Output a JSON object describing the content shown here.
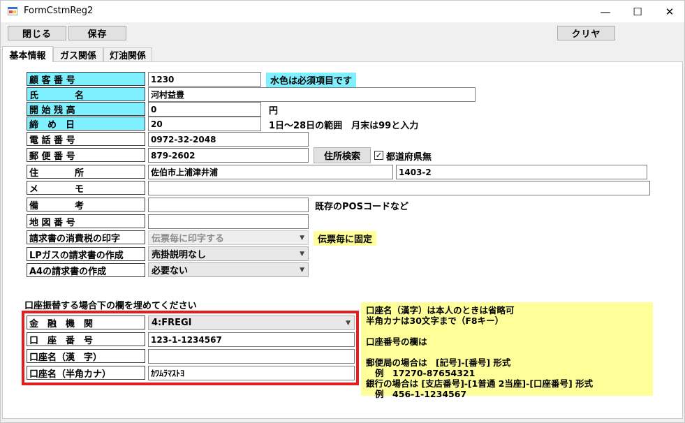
{
  "window": {
    "title": "FormCstmReg2",
    "min_glyph": "—",
    "max_glyph": "☐",
    "close_glyph": "✕"
  },
  "toolbar": {
    "close_label": "閉じる",
    "save_label": "保存",
    "clear_label": "クリヤ"
  },
  "tabs": [
    {
      "label": "基本情報"
    },
    {
      "label": "ガス関係"
    },
    {
      "label": "灯油関係"
    }
  ],
  "form": {
    "customer_no": {
      "label": "顧 客 番 号",
      "value": "1230"
    },
    "required_note": "水色は必須項目です",
    "name": {
      "label": "氏　　　　名",
      "value": "河村益豊"
    },
    "opening_balance": {
      "label": "開 始 残 高",
      "value": "0",
      "unit": "円"
    },
    "closing_day": {
      "label": "締　め　日",
      "value": "20",
      "hint": "1日～28日の範囲　月末は99と入力"
    },
    "phone": {
      "label": "電 話 番 号",
      "value": "0972-32-2048"
    },
    "postal": {
      "label": "郵 便 番 号",
      "value": "879-2602",
      "search_label": "住所検索",
      "check_label": "都道府県無",
      "checked": true
    },
    "address": {
      "label": "住　　　　所",
      "value1": "佐伯市上浦津井浦",
      "value2": "1403-2"
    },
    "memo": {
      "label": "メ　　　　モ",
      "value": ""
    },
    "remarks": {
      "label": "備　　　　考",
      "value": "",
      "hint": "既存のPOSコードなど"
    },
    "map_no": {
      "label": "地 図 番 号",
      "value": ""
    },
    "tax_print": {
      "label": "請求書の消費税の印字",
      "value": "伝票毎に印字する",
      "note": "伝票毎に固定"
    },
    "lpgas_invoice": {
      "label": "LPガスの請求書の作成",
      "value": "売掛説明なし"
    },
    "a4_invoice": {
      "label": "A4の請求書の作成",
      "value": "必要ない"
    }
  },
  "bank": {
    "heading": "口座振替する場合下の欄を埋めてください",
    "institution": {
      "label": "金　融　機　関",
      "value": "4:FREGI"
    },
    "account_no": {
      "label": "口　座　番　号",
      "value": "123-1-1234567"
    },
    "name_kanji": {
      "label": "口座名（漢　字）",
      "value": ""
    },
    "name_kana": {
      "label": "口座名（半角カナ）",
      "value": "ｶﾜﾑﾗﾏｽﾄﾖ"
    },
    "notes": [
      "口座名（漢字）は本人のときは省略可",
      "半角カナは30文字まで（F8キー）",
      "",
      "口座番号の欄は",
      "",
      "郵便局の場合は　[記号]-[番号] 形式",
      "   例　17270-87654321",
      "銀行の場合は [支店番号]-[1普通 2当座]-[口座番号] 形式",
      "   例　456-1-1234567"
    ]
  }
}
